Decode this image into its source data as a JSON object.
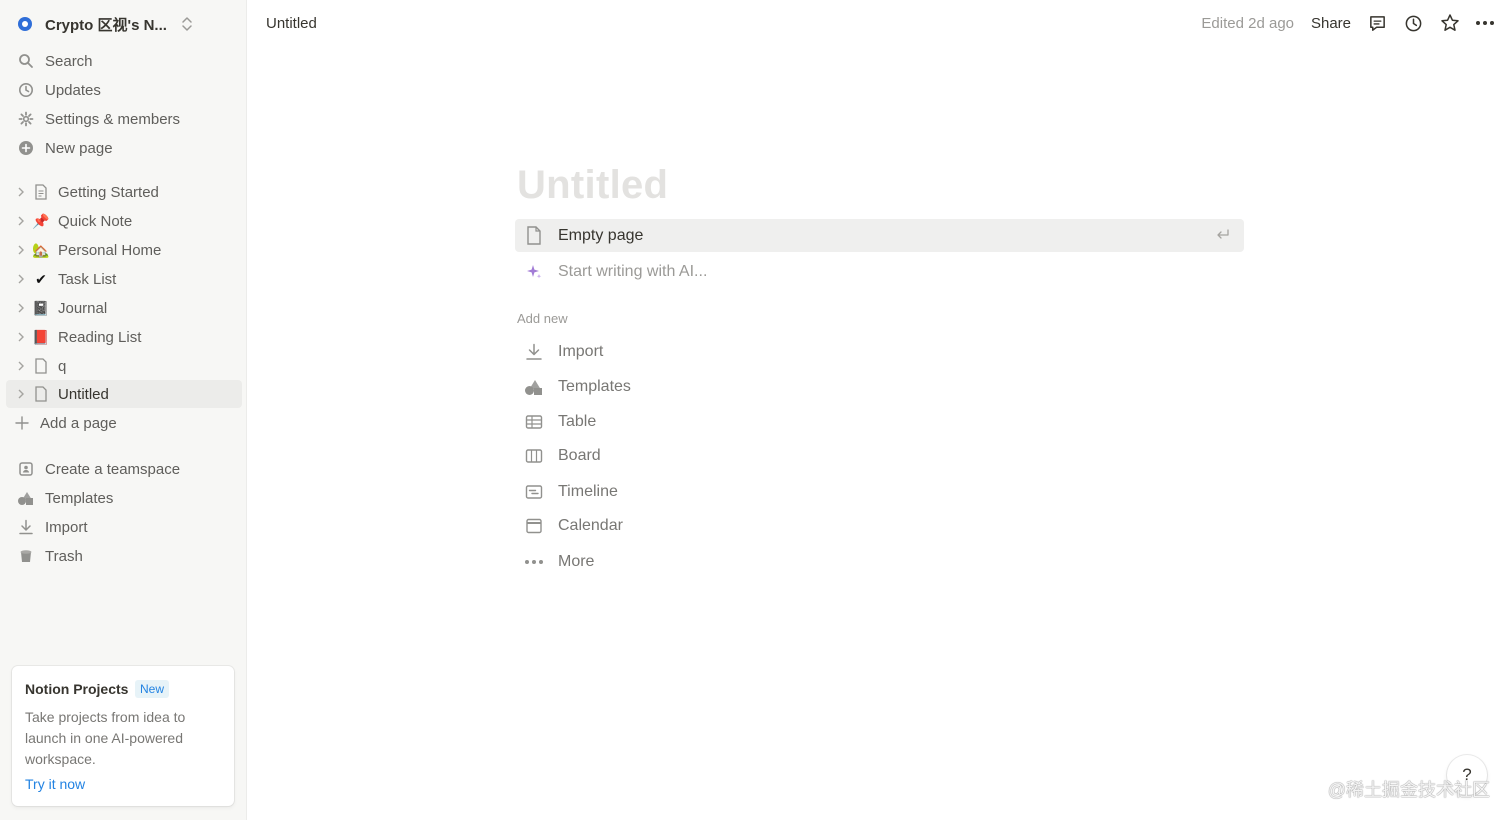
{
  "sidebar": {
    "workspace": {
      "name": "Crypto 区视's N...",
      "logo_color": "#2f6ed8"
    },
    "nav": [
      {
        "label": "Search",
        "icon": "search-icon"
      },
      {
        "label": "Updates",
        "icon": "clock-icon"
      },
      {
        "label": "Settings & members",
        "icon": "gear-icon"
      },
      {
        "label": "New page",
        "icon": "plus-circle-icon"
      }
    ],
    "pages": [
      {
        "label": "Getting Started",
        "icon": "page-icon",
        "emoji": ""
      },
      {
        "label": "Quick Note",
        "icon": "pushpin-icon",
        "emoji": "📌"
      },
      {
        "label": "Personal Home",
        "icon": "house-icon",
        "emoji": "🏡"
      },
      {
        "label": "Task List",
        "icon": "checkmark-icon",
        "emoji": "✔"
      },
      {
        "label": "Journal",
        "icon": "notebook-icon",
        "emoji": "📓"
      },
      {
        "label": "Reading List",
        "icon": "book-icon",
        "emoji": "📕"
      },
      {
        "label": "q",
        "icon": "page-icon",
        "emoji": ""
      },
      {
        "label": "Untitled",
        "icon": "page-icon",
        "emoji": "",
        "active": true
      }
    ],
    "add_page": "Add a page",
    "bottom": [
      {
        "label": "Create a teamspace",
        "icon": "teamspace-icon"
      },
      {
        "label": "Templates",
        "icon": "shapes-icon"
      },
      {
        "label": "Import",
        "icon": "download-icon"
      },
      {
        "label": "Trash",
        "icon": "trash-icon"
      }
    ],
    "promo": {
      "title": "Notion Projects",
      "badge": "New",
      "description": "Take projects from idea to launch in one AI-powered workspace.",
      "link": "Try it now"
    }
  },
  "topbar": {
    "breadcrumb": "Untitled",
    "edited": "Edited 2d ago",
    "share": "Share",
    "icons": [
      "comment-icon",
      "history-icon",
      "star-icon",
      "more-icon"
    ]
  },
  "main": {
    "title_placeholder": "Untitled",
    "options": [
      {
        "label": "Empty page",
        "icon": "page-icon"
      },
      {
        "label": "Start writing with AI...",
        "icon": "sparkle-icon"
      }
    ],
    "add_new_label": "Add new",
    "add_new": [
      {
        "label": "Import",
        "icon": "download-icon"
      },
      {
        "label": "Templates",
        "icon": "shapes-icon"
      },
      {
        "label": "Table",
        "icon": "table-icon"
      },
      {
        "label": "Board",
        "icon": "board-icon"
      },
      {
        "label": "Timeline",
        "icon": "timeline-icon"
      },
      {
        "label": "Calendar",
        "icon": "calendar-icon"
      },
      {
        "label": "More",
        "icon": "more-icon"
      }
    ]
  },
  "help": "?",
  "watermark": "@稀土掘金技术社区",
  "colors": {
    "accent": "#2383e2",
    "sidebar_bg": "#f7f7f5",
    "hover_bg": "#efefee",
    "ai_purple": "#a27cd6"
  }
}
